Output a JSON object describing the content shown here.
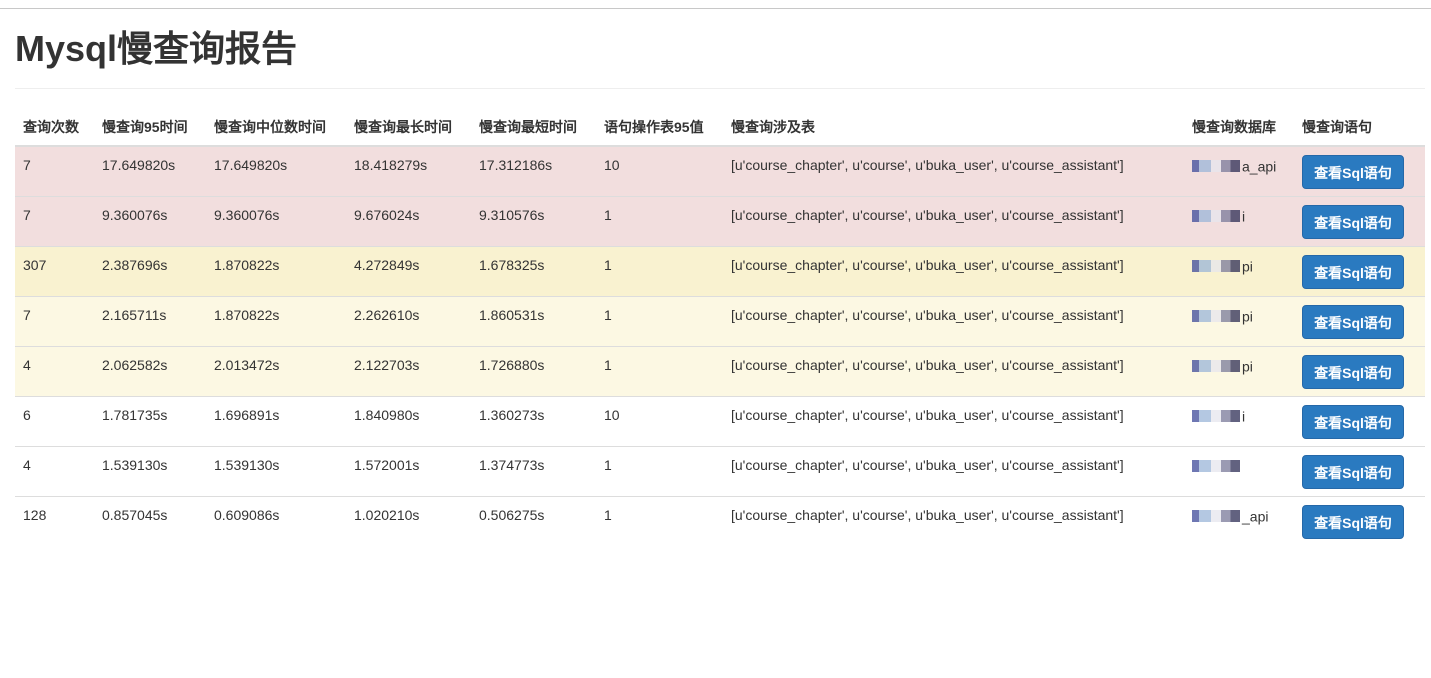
{
  "page": {
    "title": "Mysql慢查询报告"
  },
  "table": {
    "headers": [
      "查询次数",
      "慢查询95时间",
      "慢查询中位数时间",
      "慢查询最长时间",
      "慢查询最短时间",
      "语句操作表95值",
      "慢查询涉及表",
      "慢查询数据库",
      "慢查询语句"
    ],
    "button_label": "查看Sql语句",
    "rows": [
      {
        "count": "7",
        "p95": "17.649820s",
        "median": "17.649820s",
        "max": "18.418279s",
        "min": "17.312186s",
        "ops95": "10",
        "tables": "[u'course_chapter', u'course', u'buka_user', u'course_assistant']",
        "db": "a_api",
        "status": "danger"
      },
      {
        "count": "7",
        "p95": "9.360076s",
        "median": "9.360076s",
        "max": "9.676024s",
        "min": "9.310576s",
        "ops95": "1",
        "tables": "[u'course_chapter', u'course', u'buka_user', u'course_assistant']",
        "db": "i",
        "status": "danger"
      },
      {
        "count": "307",
        "p95": "2.387696s",
        "median": "1.870822s",
        "max": "4.272849s",
        "min": "1.678325s",
        "ops95": "1",
        "tables": "[u'course_chapter', u'course', u'buka_user', u'course_assistant']",
        "db": "pi",
        "status": "warning-strong"
      },
      {
        "count": "7",
        "p95": "2.165711s",
        "median": "1.870822s",
        "max": "2.262610s",
        "min": "1.860531s",
        "ops95": "1",
        "tables": "[u'course_chapter', u'course', u'buka_user', u'course_assistant']",
        "db": "pi",
        "status": "warning"
      },
      {
        "count": "4",
        "p95": "2.062582s",
        "median": "2.013472s",
        "max": "2.122703s",
        "min": "1.726880s",
        "ops95": "1",
        "tables": "[u'course_chapter', u'course', u'buka_user', u'course_assistant']",
        "db": "pi",
        "status": "warning"
      },
      {
        "count": "6",
        "p95": "1.781735s",
        "median": "1.696891s",
        "max": "1.840980s",
        "min": "1.360273s",
        "ops95": "10",
        "tables": "[u'course_chapter', u'course', u'buka_user', u'course_assistant']",
        "db": "i",
        "status": "plain"
      },
      {
        "count": "4",
        "p95": "1.539130s",
        "median": "1.539130s",
        "max": "1.572001s",
        "min": "1.374773s",
        "ops95": "1",
        "tables": "[u'course_chapter', u'course', u'buka_user', u'course_assistant']",
        "db": "",
        "status": "plain"
      },
      {
        "count": "128",
        "p95": "0.857045s",
        "median": "0.609086s",
        "max": "1.020210s",
        "min": "0.506275s",
        "ops95": "1",
        "tables": "[u'course_chapter', u'course', u'buka_user', u'course_assistant']",
        "db": "_api",
        "status": "plain"
      }
    ]
  }
}
